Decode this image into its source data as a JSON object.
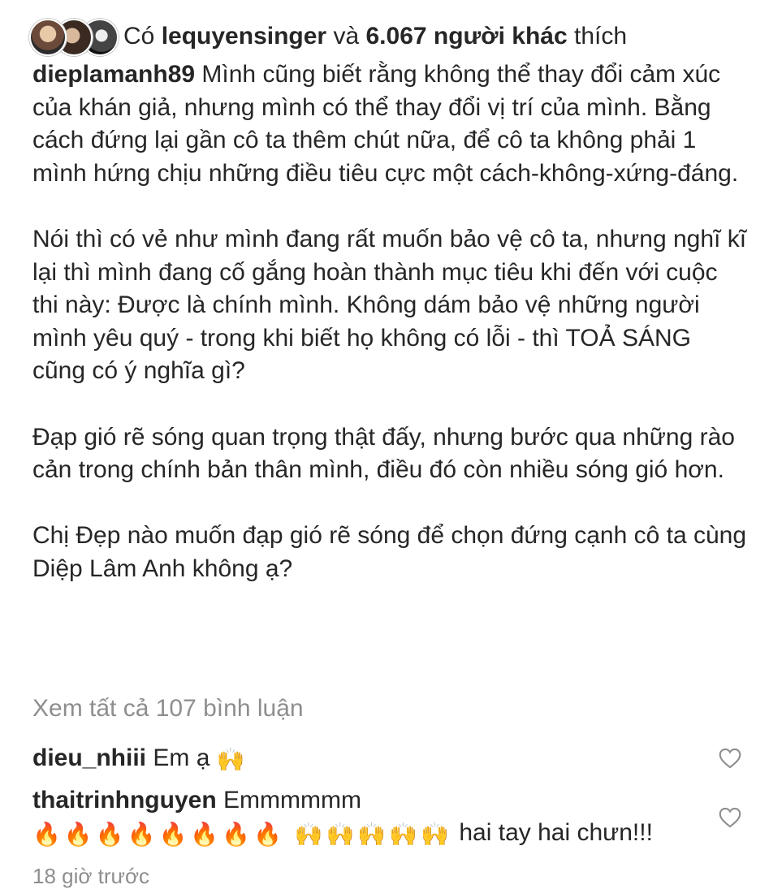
{
  "likes": {
    "prefix": "Có",
    "user": "lequyensinger",
    "connector": "và",
    "others": "6.067 người khác",
    "suffix": "thích"
  },
  "caption": {
    "username": "dieplamanh89",
    "paragraphs": [
      "Mình cũng biết rằng không thể thay đổi cảm xúc của khán giả, nhưng mình có thể thay đổi vị trí của mình. Bằng cách đứng lại gần cô ta thêm chút nữa, để cô ta không phải 1 mình hứng chịu những điều tiêu cực một cách-không-xứng-đáng.",
      "Nói thì có vẻ như mình đang rất muốn bảo vệ cô ta, nhưng nghĩ kĩ lại thì mình đang cố gắng hoàn thành mục tiêu khi đến với cuộc thi này: Được là chính mình. Không dám bảo vệ những người mình yêu quý - trong khi biết họ không có lỗi - thì TOẢ SÁNG cũng có ý nghĩa gì?",
      "Đạp gió rẽ sóng quan trọng thật đấy, nhưng bước qua những rào cản trong chính bản thân mình, điều đó còn nhiều  sóng gió hơn.",
      "Chị Đẹp nào muốn đạp gió rẽ sóng để chọn đứng cạnh cô ta cùng Diệp Lâm Anh không ạ?"
    ]
  },
  "view_all": "Xem tất cả 107 bình luận",
  "comments": [
    {
      "username": "dieu_nhiii",
      "text": "Em ạ",
      "emoji": "🙌"
    },
    {
      "username": "thaitrinhnguyen",
      "text": "Emmmmmm",
      "emoji": "🔥🔥🔥🔥🔥🔥🔥🔥 🙌🙌🙌🙌🙌",
      "text_after": "hai tay hai chưn!!!"
    }
  ],
  "timestamp": "18 giờ trước",
  "icons": {
    "heart": "heart-icon",
    "avatar": "avatar"
  }
}
